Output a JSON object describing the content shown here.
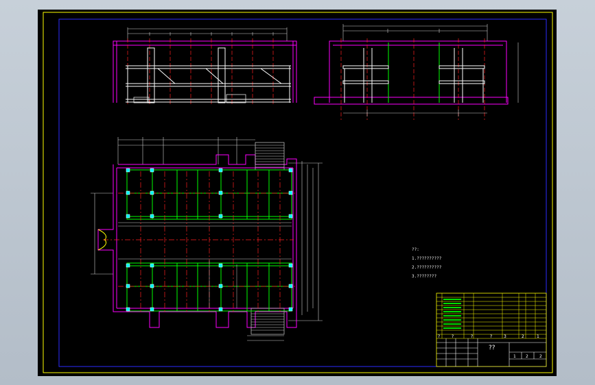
{
  "notes": {
    "title": "??:",
    "lines": [
      "1.??????????",
      "2.??????????",
      "3.????????"
    ]
  },
  "title_block": {
    "drawing_title": "??",
    "cell_a": "?",
    "cell_b": "?",
    "cell_c": "?",
    "cell_d": "?",
    "cell_e": "3",
    "cell_f": "2",
    "cell_g": "1",
    "sheet_1": "1",
    "sheet_2": "2",
    "sheet_3": "2"
  },
  "colors": {
    "background": "#000000",
    "frame": "#ffff00",
    "border": "#0000ff",
    "outline": "#ff00ff",
    "beam": "#00ff00",
    "axis": "#ff0000",
    "dimension": "#ffffff",
    "column": "#00ffff"
  }
}
